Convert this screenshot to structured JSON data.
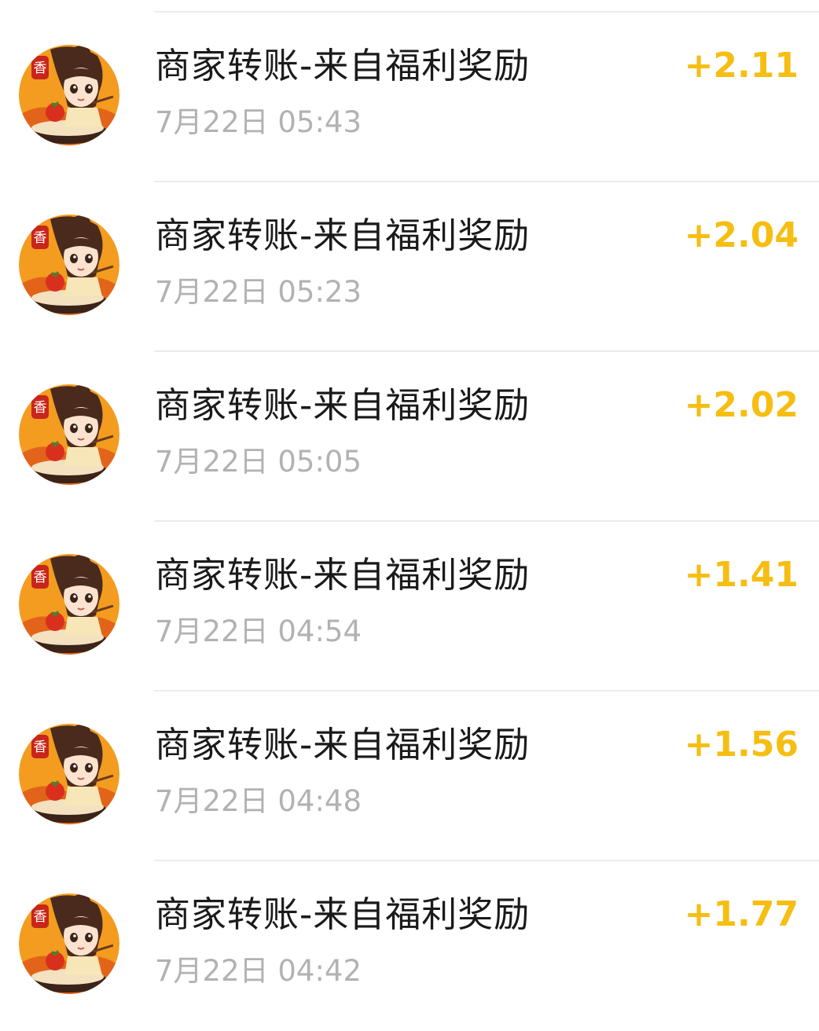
{
  "accent_color": "#f6be12",
  "avatar_icon": "chef-girl-avatar-icon",
  "avatar_badge_text": "香",
  "transactions": [
    {
      "title": "商家转账-来自福利奖励",
      "time": "7月22日 05:43",
      "amount": "+2.11"
    },
    {
      "title": "商家转账-来自福利奖励",
      "time": "7月22日 05:23",
      "amount": "+2.04"
    },
    {
      "title": "商家转账-来自福利奖励",
      "time": "7月22日 05:05",
      "amount": "+2.02"
    },
    {
      "title": "商家转账-来自福利奖励",
      "time": "7月22日 04:54",
      "amount": "+1.41"
    },
    {
      "title": "商家转账-来自福利奖励",
      "time": "7月22日 04:48",
      "amount": "+1.56"
    },
    {
      "title": "商家转账-来自福利奖励",
      "time": "7月22日 04:42",
      "amount": "+1.77"
    }
  ]
}
